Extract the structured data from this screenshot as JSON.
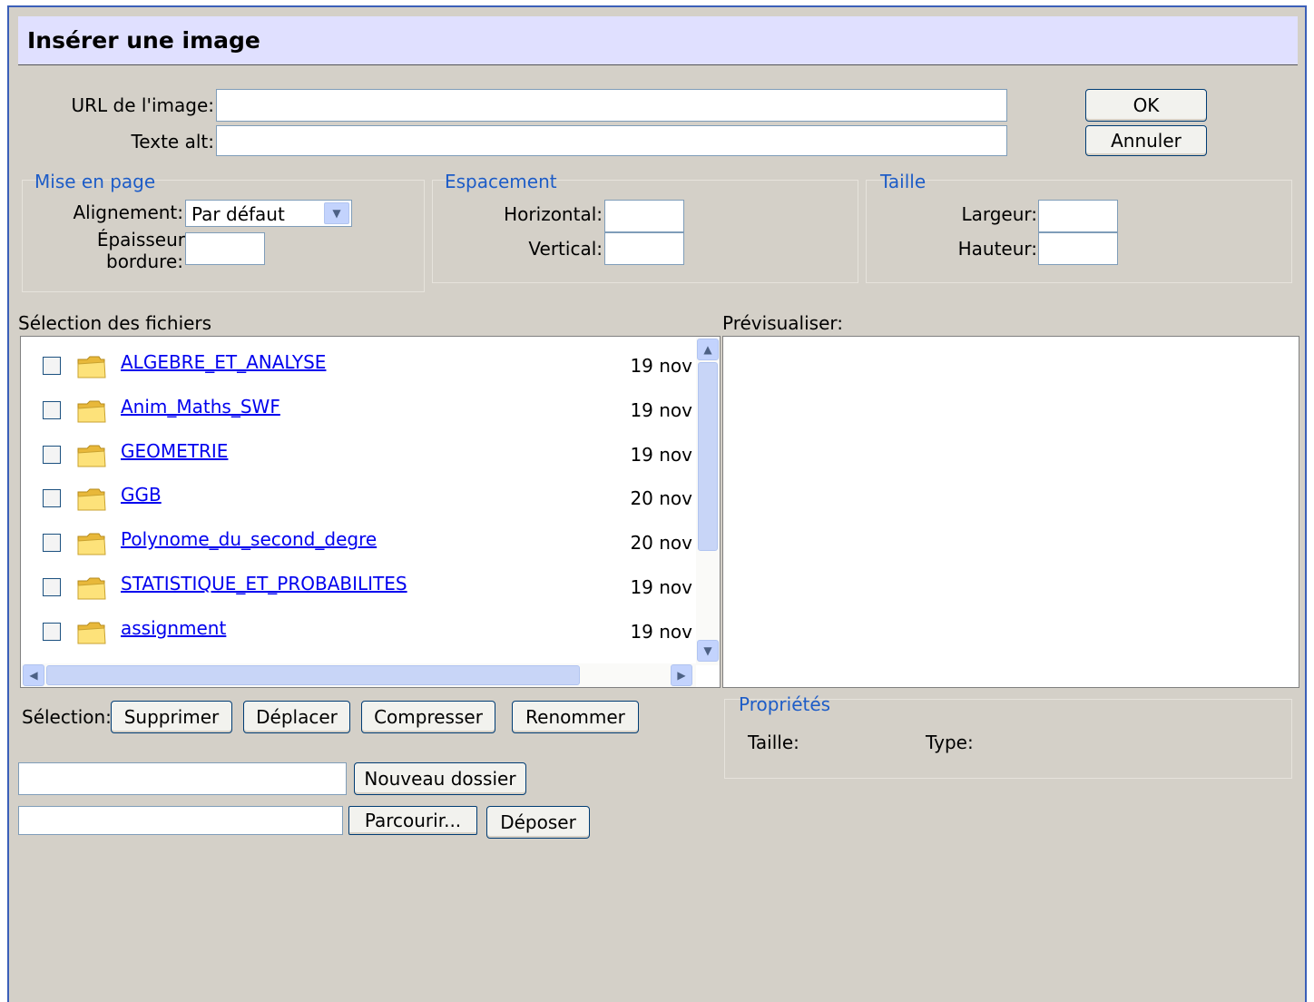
{
  "dialog": {
    "title": "Insérer une image",
    "url_label": "URL de l'image:",
    "url_value": "",
    "alt_label": "Texte alt:",
    "alt_value": "",
    "ok_label": "OK",
    "cancel_label": "Annuler"
  },
  "layout_group": {
    "legend": "Mise en page",
    "alignment_label": "Alignement:",
    "alignment_value": "Par défaut",
    "border_label_1": "Épaisseur",
    "border_label_2": "bordure:",
    "border_value": ""
  },
  "spacing_group": {
    "legend": "Espacement",
    "horizontal_label": "Horizontal:",
    "vertical_label": "Vertical:"
  },
  "size_group": {
    "legend": "Taille",
    "width_label": "Largeur:",
    "height_label": "Hauteur:"
  },
  "files": {
    "header": "Sélection des fichiers",
    "items": [
      {
        "name": "ALGEBRE_ET_ANALYSE",
        "date": "19 nov"
      },
      {
        "name": "Anim_Maths_SWF",
        "date": "19 nov"
      },
      {
        "name": "GEOMETRIE",
        "date": "19 nov"
      },
      {
        "name": "GGB",
        "date": "20 nov"
      },
      {
        "name": "Polynome_du_second_degre",
        "date": "20 nov"
      },
      {
        "name": "STATISTIQUE_ET_PROBABILITES",
        "date": "19 nov"
      },
      {
        "name": "assignment",
        "date": "19 nov"
      }
    ]
  },
  "preview": {
    "header": "Prévisualiser:"
  },
  "selection": {
    "label": "Sélection:",
    "delete": "Supprimer",
    "move": "Déplacer",
    "compress": "Compresser",
    "rename": "Renommer"
  },
  "properties": {
    "legend": "Propriétés",
    "size_label": "Taille:",
    "type_label": "Type:"
  },
  "actions": {
    "new_folder": "Nouveau dossier",
    "browse": "Parcourir...",
    "upload": "Déposer"
  },
  "icons": {
    "folder": "folder-icon",
    "scroll_up": "chevron-up-icon",
    "scroll_down": "chevron-down-icon",
    "scroll_left": "chevron-left-icon",
    "scroll_right": "chevron-right-icon"
  },
  "colors": {
    "dialog_bg": "#d4d0c8",
    "titlebar_bg": "#e0e0ff",
    "legend": "#1d5cc7",
    "link": "#0000ee"
  }
}
